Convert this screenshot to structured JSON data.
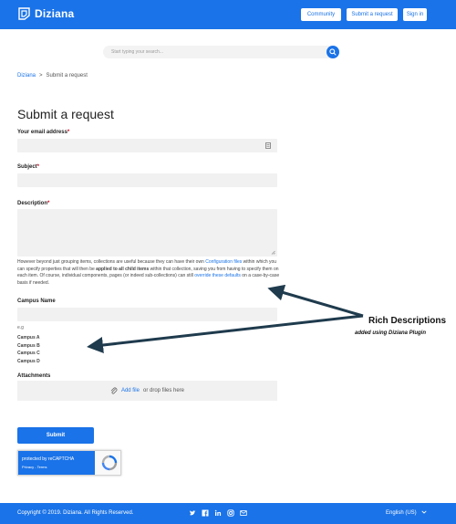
{
  "header": {
    "brand": "Diziana",
    "nav": [
      "Community",
      "Submit a request",
      "Sign in"
    ]
  },
  "search": {
    "placeholder": "Start typing your search..."
  },
  "breadcrumb": {
    "home": "Diziana",
    "separator": ">",
    "current": "Submit a request"
  },
  "form": {
    "title": "Submit a request",
    "email_label": "Your email address",
    "subject_label": "Subject",
    "description_label": "Description",
    "required_mark": "*",
    "help": {
      "p1": "However beyond just grouping items, collections are useful because they can have their own ",
      "link1": "Configuration files",
      "p2": " within which you can specify properties that will then be ",
      "bold": "applied to all child items",
      "p3": " within that collection, saving you from having to specify them on each item. Of course, individual components, pages (or indeed sub-collections) can still ",
      "link2": "override these defaults",
      "p4": " on a case-by-case basis if needed."
    },
    "campus_label": "Campus Name",
    "campus_eg": "e.g",
    "campus_options": [
      "Campus A",
      "Campus B",
      "Campus C",
      "Campus D"
    ],
    "attachments_label": "Attachments",
    "attach_link": "Add file",
    "attach_text": "or drop files here",
    "submit_label": "Submit"
  },
  "captcha": {
    "title": "protected by reCAPTCHA",
    "links": "Privacy - Terms"
  },
  "annotation": {
    "title": "Rich Descriptions",
    "subtitle": "added using Diziana Plugin"
  },
  "footer": {
    "copyright": "Copyright © 2019. Diziana. All Rights Reserved.",
    "socials": [
      "twitter-icon",
      "facebook-icon",
      "linkedin-icon",
      "instagram-icon",
      "email-icon"
    ],
    "language": "English (US)"
  },
  "colors": {
    "brand": "#1a73e8",
    "field": "#f1f1f1",
    "arrow": "#1f3b4d"
  }
}
